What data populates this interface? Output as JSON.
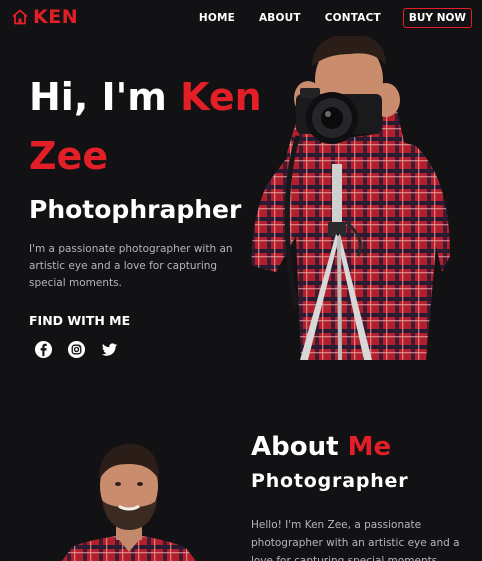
{
  "brand": {
    "name": "KEN",
    "icon": "home-icon",
    "color": "#e21f26"
  },
  "nav": {
    "links": [
      "HOME",
      "ABOUT",
      "CONTACT"
    ],
    "cta": "BUY NOW"
  },
  "hero": {
    "greeting": "Hi, I'm ",
    "first_name": "Ken",
    "last_name": "Zee",
    "role": "Photophrapher",
    "intro": "I'm a passionate photographer with an artistic eye and a love for capturing special moments.",
    "find_label": "FIND WITH ME",
    "social": [
      "facebook-icon",
      "instagram-icon",
      "twitter-icon"
    ]
  },
  "about": {
    "title_white": "About ",
    "title_red": "Me",
    "subtitle": "Photographer",
    "text": "Hello! I'm Ken Zee, a passionate photographer with an artistic eye and a love for capturing special moments. With"
  },
  "colors": {
    "accent": "#e21f26",
    "background": "#121113"
  }
}
